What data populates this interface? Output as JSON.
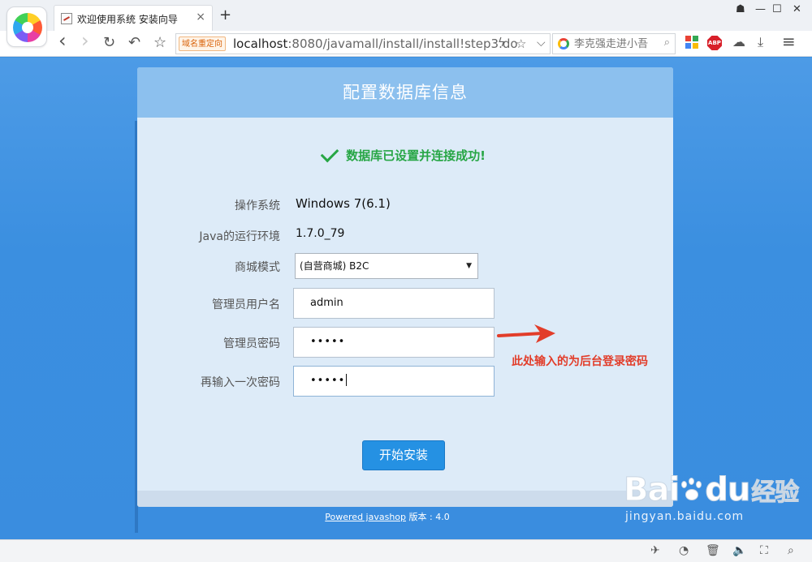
{
  "browser": {
    "tab_title": "欢迎使用系统 安装向导",
    "tab_close": "×",
    "new_tab": "+",
    "window_controls": {
      "skin": "☗",
      "minimize": "—",
      "maximize": "☐",
      "close": "✕"
    },
    "nav": {
      "back": "‹",
      "forward": "›",
      "reload": "↻",
      "undo": "↶",
      "favorite": "☆"
    },
    "address_badge": "域名重定向",
    "url_host": "localhost",
    "url_rest": ":8080/javamall/install/install!step3.do",
    "address_icons": {
      "lightning": "ϟ",
      "star": "☆",
      "dropdown": "⌵"
    },
    "search_placeholder": "李克强走进小吾",
    "search_go": "⌕",
    "extensions": {
      "abp": "ABP",
      "cloud": "☁",
      "download": "⤓",
      "menu": "≡"
    },
    "extension_grid_colors": [
      "#e94235",
      "#34a853",
      "#4285f4",
      "#fbbc05"
    ]
  },
  "page": {
    "title": "配置数据库信息",
    "success_message": "数据库已设置并连接成功!",
    "rows": {
      "os_label": "操作系统",
      "os_value": "Windows 7(6.1)",
      "java_label": "Java的运行环境",
      "java_value": "1.7.0_79",
      "mode_label": "商城模式",
      "mode_value": "(自营商城)  B2C",
      "admin_label": "管理员用户名",
      "admin_value": "admin",
      "password_label": "管理员密码",
      "password_value": "•••••",
      "confirm_label": "再输入一次密码",
      "confirm_value": "•••••"
    },
    "submit_label": "开始安装",
    "annotation": "此处输入的为后台登录密码",
    "powered_link": "Powered javashop",
    "version_text": " 版本 : 4.0"
  },
  "watermark": {
    "logo_left": "Bai",
    "logo_right": "du",
    "jingyan": "经验",
    "url": "jingyan.baidu.com"
  },
  "statusbar": {
    "icons": {
      "pin": "✈",
      "speed": "◔",
      "trash": "🗑",
      "sound": "🔈",
      "fullscreen": "⛶",
      "zoom": "⌕"
    }
  },
  "colors": {
    "page_bg": "#3b8fe0",
    "header_bg": "#8cc0ee",
    "success": "#27a645",
    "button": "#2591e3",
    "annotation": "#e23d2a"
  }
}
